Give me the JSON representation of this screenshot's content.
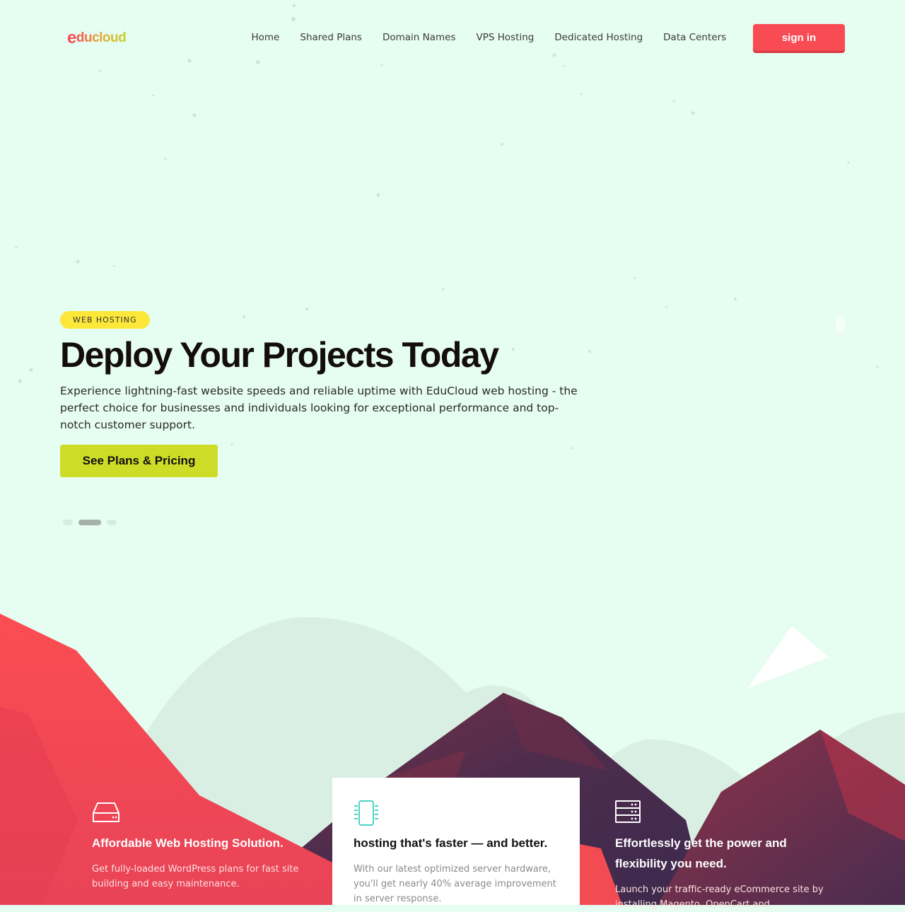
{
  "header": {
    "logo_first": "e",
    "logo_rest": "ducloud",
    "nav": [
      "Home",
      "Shared Plans",
      "Domain Names",
      "VPS Hosting",
      "Dedicated Hosting",
      "Data Centers"
    ],
    "signin_label": "sign in"
  },
  "hero": {
    "badge": "WEB HOSTING",
    "title": "Deploy Your Projects Today",
    "lead": "Experience lightning-fast website speeds and reliable uptime with EduCloud web hosting - the perfect choice for businesses and individuals looking for exceptional performance and top-notch customer support.",
    "cta_label": "See Plans & Pricing",
    "slides": 3,
    "active_slide": 2
  },
  "features": [
    {
      "icon": "hard-drive-icon",
      "title": "Affordable Web Hosting Solution.",
      "desc": "Get fully-loaded WordPress plans for fast site building and easy maintenance."
    },
    {
      "icon": "cpu-chip-icon",
      "title": "hosting that's faster — and better.",
      "desc": "With our latest optimized server hardware, you'll get nearly 40% average improvement in server response."
    },
    {
      "icon": "server-rack-icon",
      "title": "Effortlessly get the power and flexibility you need.",
      "desc": "Launch your traffic-ready eCommerce site by installing Magento, OpenCart and"
    }
  ],
  "colors": {
    "background": "#e6fdf1",
    "accent_red": "#f84b54",
    "accent_lime": "#cddc27",
    "badge_yellow": "#fde83a",
    "mountain_purple": "#5a3350",
    "icon_teal": "#4fd3c4"
  }
}
